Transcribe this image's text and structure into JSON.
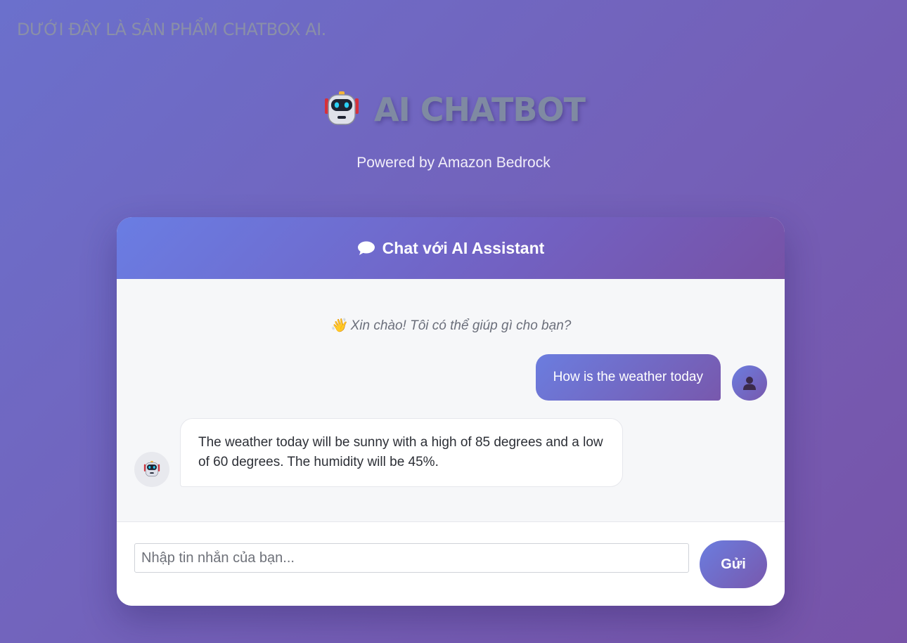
{
  "page": {
    "top_note": "Dưới đây là sản phẩm chatbox AI.",
    "title": "AI CHATBOT",
    "subtitle": "Powered by Amazon Bedrock"
  },
  "chat": {
    "header_title": "Chat với AI Assistant",
    "welcome": "👋 Xin chào! Tôi có thể giúp gì cho bạn?",
    "messages": [
      {
        "role": "user",
        "text": "How is the weather today"
      },
      {
        "role": "bot",
        "text": "The weather today will be sunny with a high of 85 degrees and a low of 60 degrees. The humidity will be 45%."
      }
    ],
    "input": {
      "placeholder": "Nhập tin nhắn của bạn...",
      "value": ""
    },
    "send_label": "Gửi"
  },
  "colors": {
    "background_start": "#6b70cc",
    "background_end": "#7753a8",
    "accent_start": "#6b7ddf",
    "accent_end": "#7858ad",
    "title_gray": "#7f8aa2"
  },
  "icons": {
    "title": "robot-icon",
    "header": "speech-bubble-icon",
    "user_avatar": "user-silhouette-icon",
    "bot_avatar": "robot-icon"
  }
}
